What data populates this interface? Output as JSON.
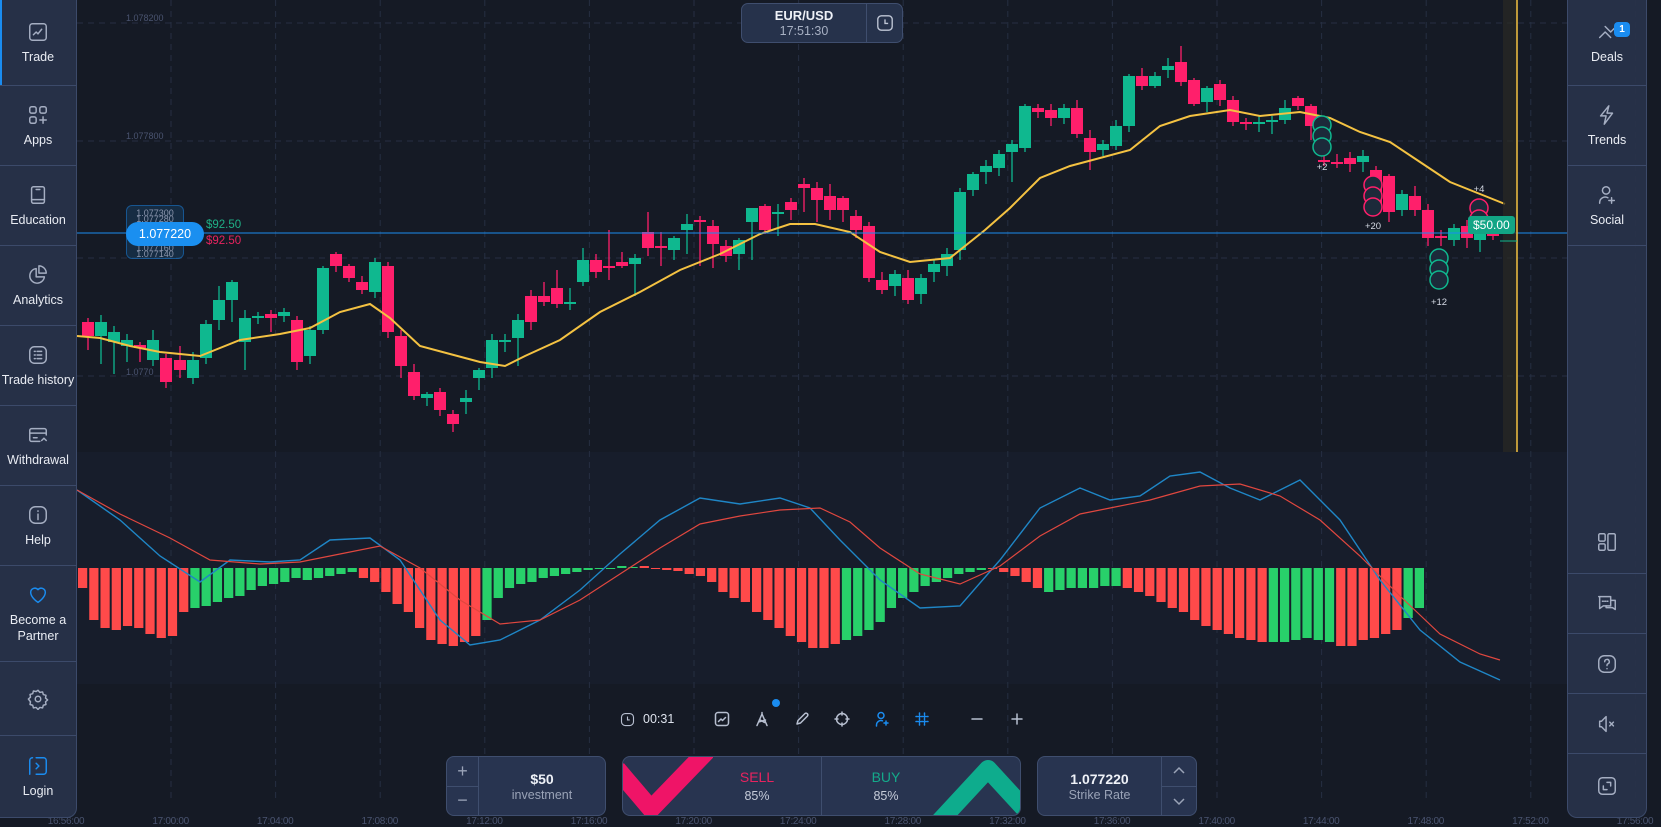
{
  "left_sidebar": {
    "items": [
      {
        "label": "Trade",
        "icon": "chart-window-icon",
        "active": true
      },
      {
        "label": "Apps",
        "icon": "apps-grid-icon"
      },
      {
        "label": "Education",
        "icon": "book-icon"
      },
      {
        "label": "Analytics",
        "icon": "pie-chart-icon"
      },
      {
        "label": "Trade history",
        "icon": "list-icon"
      },
      {
        "label": "Withdrawal",
        "icon": "card-icon"
      },
      {
        "label": "Help",
        "icon": "info-icon"
      },
      {
        "label": "Become a Partner",
        "icon": "heart-icon"
      },
      {
        "label": "",
        "icon": "gear-icon"
      },
      {
        "label": "Login",
        "icon": "login-icon"
      }
    ]
  },
  "right_sidebar": {
    "items": [
      {
        "label": "Deals",
        "icon": "deals-icon",
        "badge": "1"
      },
      {
        "label": "Trends",
        "icon": "lightning-icon"
      },
      {
        "label": "Social",
        "icon": "add-user-icon"
      }
    ],
    "bottom_icons": [
      "layout-icon",
      "chat-icon",
      "question-icon",
      "mute-icon",
      "fullscreen-icon"
    ]
  },
  "header": {
    "pair": "EUR/USD",
    "time": "17:51:30"
  },
  "price": {
    "current": "1.077220",
    "ghost_top": [
      "1.077300",
      "1.077280"
    ],
    "ghost_bottom": [
      "1.077160",
      "1.077140"
    ],
    "payout_up": "$92.50",
    "payout_down": "$92.50"
  },
  "y_ticks": [
    "1.078200",
    "1.077800",
    "1.0770"
  ],
  "x_ticks": [
    "16:56:00",
    "17:00:00",
    "17:04:00",
    "17:08:00",
    "17:12:00",
    "17:16:00",
    "17:20:00",
    "17:24:00",
    "17:28:00",
    "17:32:00",
    "17:36:00",
    "17:40:00",
    "17:44:00",
    "17:48:00",
    "17:52:00",
    "17:56:00"
  ],
  "social_clusters": [
    {
      "count": "+2"
    },
    {
      "count": "+20"
    },
    {
      "count": "+12"
    },
    {
      "count": "+4"
    }
  ],
  "deal_tag": "$50.00",
  "toolbar": {
    "timer": "00:31",
    "icons": [
      "chart-type-icon",
      "indicators-icon",
      "pencil-icon",
      "crosshair-icon",
      "social-user-icon",
      "grid-icon",
      "zoom-out-icon",
      "zoom-in-icon"
    ]
  },
  "investment": {
    "value": "$50",
    "label": "investment",
    "plus": "+",
    "minus": "−"
  },
  "sell": {
    "label": "SELL",
    "payout": "85%"
  },
  "buy": {
    "label": "BUY",
    "payout": "85%"
  },
  "strike": {
    "value": "1.077220",
    "label": "Strike Rate"
  },
  "colors": {
    "bull": "#0fb88f",
    "bear": "#ff1f6b",
    "ma": "#f4c242",
    "macd_line": "#1f86c6",
    "signal_line": "#e0473f",
    "hist_up": "#28d06a",
    "hist_down": "#ff4a4a",
    "accent": "#1a8cf0"
  }
}
